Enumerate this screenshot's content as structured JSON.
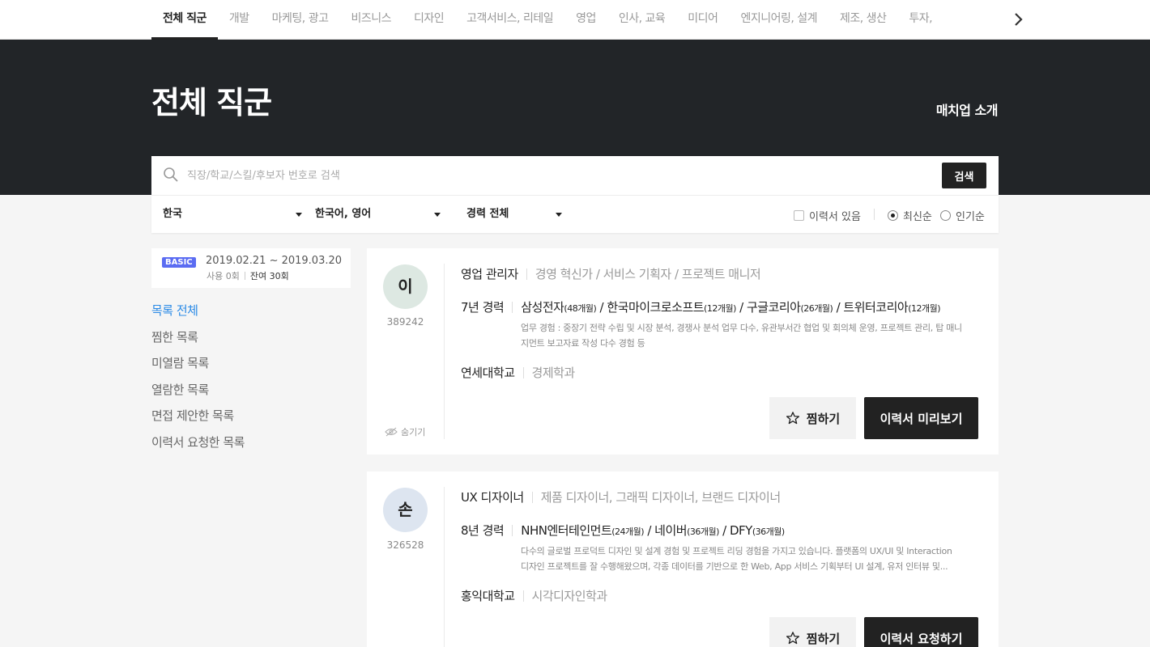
{
  "nav": {
    "tabs": [
      "전체 직군",
      "개발",
      "마케팅, 광고",
      "비즈니스",
      "디자인",
      "고객서비스, 리테일",
      "영업",
      "인사, 교육",
      "미디어",
      "엔지니어링, 설계",
      "제조, 생산",
      "투자,"
    ],
    "active_index": 0,
    "next_icon": "chevron-right-icon"
  },
  "hero": {
    "title": "전체 직군",
    "intro_link": "매치업 소개"
  },
  "search": {
    "placeholder": "직장/학교/스킬/후보자 번호로 검색",
    "button": "검색",
    "icon": "search-icon"
  },
  "filters": {
    "country": "한국",
    "language": "한국어, 영어",
    "career": "경력 전체",
    "has_resume": "이력서 있음",
    "sort_latest": "최신순",
    "sort_popular": "인기순",
    "sort_selected": "최신순"
  },
  "plan": {
    "badge": "BASIC",
    "period": "2019.02.21 ~ 2019.03.20",
    "used": "사용 0회",
    "remaining": "잔여 30회"
  },
  "sidebar": {
    "items": [
      "목록 전체",
      "찜한 목록",
      "미열람 목록",
      "열람한 목록",
      "면접 제안한 목록",
      "이력서 요청한 목록"
    ],
    "active_index": 0
  },
  "candidates": [
    {
      "initial": "이",
      "avatar_color": "#dde8e2",
      "id": "389242",
      "hide_label": "숨기기",
      "role": "영업 관리자",
      "sub_roles": "경영 혁신가 / 서비스 기획자 / 프로젝트 매니저",
      "years": "7년 경력",
      "companies": [
        {
          "name": "삼성전자",
          "months": "(48개월)"
        },
        {
          "name": "한국마이크로소프트",
          "months": "(12개월)"
        },
        {
          "name": "구글코리아",
          "months": "(26개월)"
        },
        {
          "name": "트위터코리아",
          "months": "(12개월)"
        }
      ],
      "desc_line1": "업무 경험 : 중장기 전략 수립 및 시장 분석, 경쟁사 분석 업무 다수, 유관부서간 협업 및 회의체 운영, 프로젝트 관리, 탑 매니",
      "desc_line2": "지먼트 보고자료 작성 다수 경험 등",
      "school": "연세대학교",
      "major": "경제학과",
      "like_label": "찜하기",
      "action_label": "이력서 미리보기"
    },
    {
      "initial": "손",
      "avatar_color": "#dde5f0",
      "id": "326528",
      "role": "UX 디자이너",
      "sub_roles": "제품 디자이너, 그래픽 디자이너, 브랜드 디자이너",
      "years": "8년 경력",
      "companies": [
        {
          "name": "NHN엔터테인먼트",
          "months": "(24개월)"
        },
        {
          "name": "네이버",
          "months": "(36개월)"
        },
        {
          "name": "DFY",
          "months": "(36개월)"
        }
      ],
      "desc_line1": "다수의 글로벌 프로덕트 디자인 및 설계 경험 및 프로젝트 리딩 경험을 가지고 있습니다. 플랫폼의 UX/UI 및 Interaction",
      "desc_line2": "디자인 프로젝트를 잘 수행해왔으며, 각종 데이터를 기반으로 한 Web, App 서비스 기획부터 UI 설계, 유저 인터뷰 및...",
      "school": "홍익대학교",
      "major": "시각디자인학과",
      "like_label": "찜하기",
      "action_label": "이력서 요청하기"
    }
  ]
}
